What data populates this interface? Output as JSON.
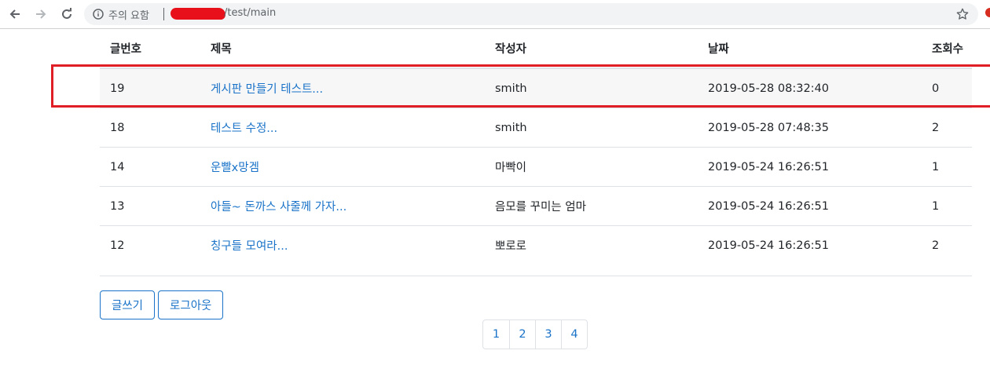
{
  "browser": {
    "security_label": "주의 요함",
    "url_suffix": "/test/main"
  },
  "board": {
    "columns": [
      "글번호",
      "제목",
      "작성자",
      "날짜",
      "조회수"
    ],
    "rows": [
      {
        "no": "19",
        "title": "게시판 만들기 테스트...",
        "writer": "smith",
        "date": "2019-05-28 08:32:40",
        "views": "0"
      },
      {
        "no": "18",
        "title": "테스트 수정...",
        "writer": "smith",
        "date": "2019-05-28 07:48:35",
        "views": "2"
      },
      {
        "no": "14",
        "title": "운빨x망겜",
        "writer": "마빡이",
        "date": "2019-05-24 16:26:51",
        "views": "1"
      },
      {
        "no": "13",
        "title": "아들~ 돈까스 사줄께 가자...",
        "writer": "음모를 꾸미는 엄마",
        "date": "2019-05-24 16:26:51",
        "views": "1"
      },
      {
        "no": "12",
        "title": "칭구들 모여라...",
        "writer": "뽀로로",
        "date": "2019-05-24 16:26:51",
        "views": "2"
      }
    ]
  },
  "actions": {
    "write_label": "글쓰기",
    "logout_label": "로그아웃"
  },
  "pagination": {
    "pages": [
      "1",
      "2",
      "3",
      "4"
    ]
  },
  "colors": {
    "link": "#1a73c8",
    "highlight": "#e01e26",
    "redaction": "#e8111b"
  }
}
